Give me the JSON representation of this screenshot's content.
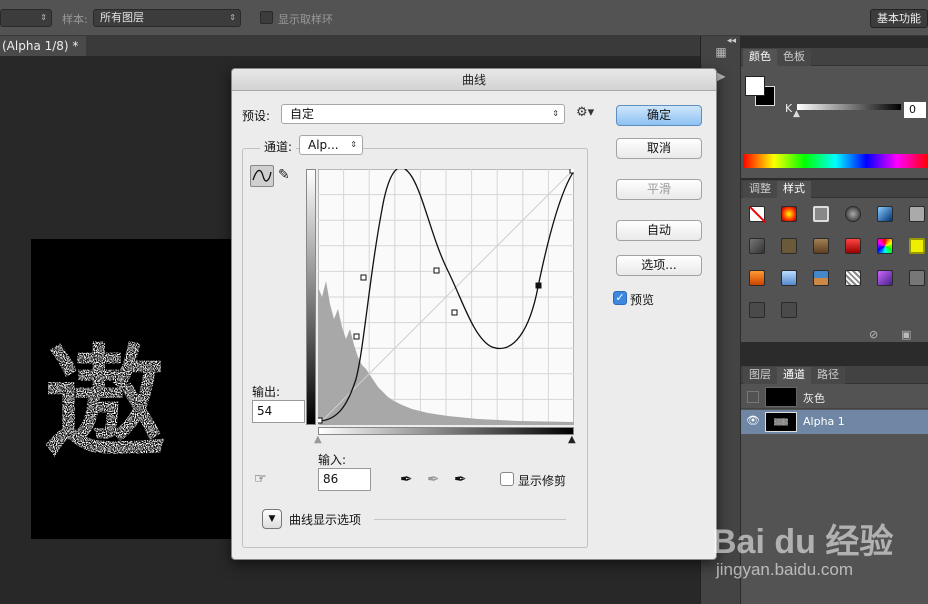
{
  "options_bar": {
    "sample_label": "样本:",
    "sample_value": "所有图层",
    "show_ring_label": "显示取样环",
    "workspace_label": "基本功能"
  },
  "document": {
    "tab_label": "(Alpha 1/8) *",
    "canvas_artwork": "遨"
  },
  "color_panel": {
    "tabs": [
      "颜色",
      "色板"
    ],
    "slider_label": "K",
    "slider_value": "0"
  },
  "styles_panel": {
    "tabs": [
      "调整",
      "样式"
    ]
  },
  "channels_panel": {
    "tabs": [
      "图层",
      "通道",
      "路径"
    ],
    "rows": [
      {
        "name": "灰色"
      },
      {
        "name": "Alpha 1"
      }
    ]
  },
  "curves_dialog": {
    "title": "曲线",
    "preset_label": "预设:",
    "preset_value": "自定",
    "channel_label": "通道:",
    "channel_value": "Alp...",
    "output_label": "输出:",
    "output_value": "54",
    "input_label": "输入:",
    "input_value": "86",
    "show_clipping_label": "显示修剪",
    "curve_options_label": "曲线显示选项",
    "buttons": {
      "ok": "确定",
      "cancel": "取消",
      "smooth": "平滑",
      "auto": "自动",
      "options": "选项...",
      "preview": "预览"
    },
    "preview_checked": true,
    "show_clipping_checked": false
  },
  "watermark": {
    "brand_text": "Bai du 经验",
    "url": "jingyan.baidu.com"
  }
}
